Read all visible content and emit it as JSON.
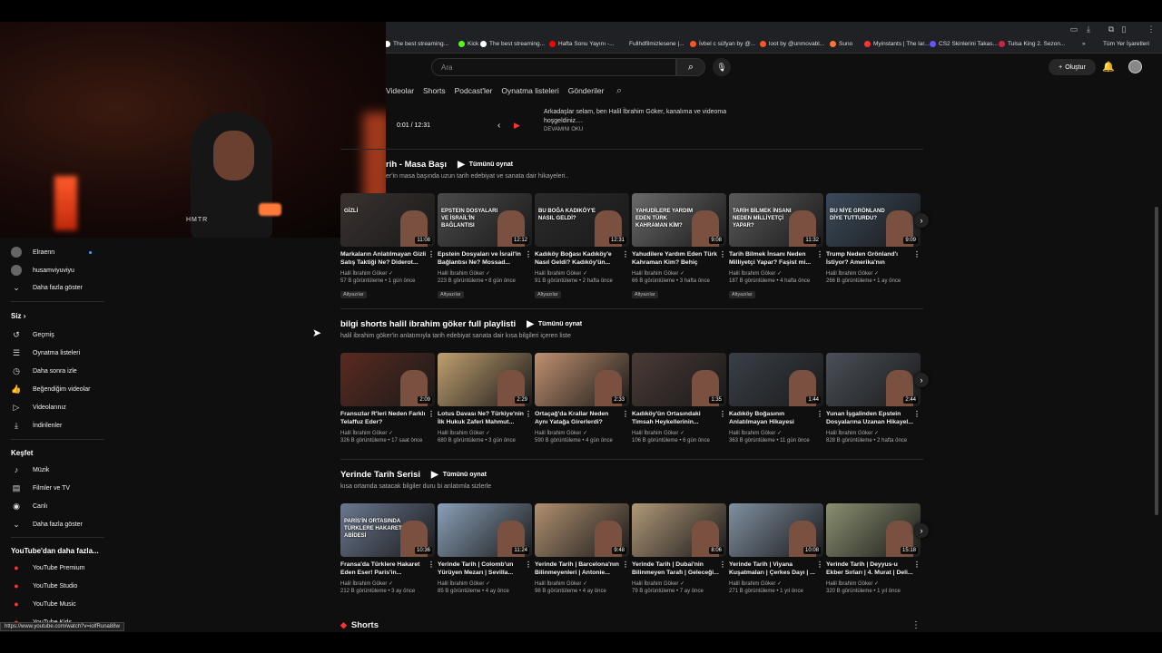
{
  "bookmarks": [
    {
      "label": "The best streaming...",
      "color": "#ffffff"
    },
    {
      "label": "Kick",
      "color": "#53fc18"
    },
    {
      "label": "The best streaming...",
      "color": "#ffffff"
    },
    {
      "label": "Hafta Sonu Yayını -...",
      "color": "#ff0000"
    },
    {
      "label": "Fullhdfilmizlesene |...",
      "color": "#222222"
    },
    {
      "label": "İvbel c süfyan by @...",
      "color": "#ff5522"
    },
    {
      "label": "loot by @unmovabl...",
      "color": "#ff5522"
    },
    {
      "label": "Suno",
      "color": "#ff7733"
    },
    {
      "label": "Myinstants | The lar...",
      "color": "#ff3333"
    },
    {
      "label": "CS2 Skinlerini Takas...",
      "color": "#6655ff"
    },
    {
      "label": "Tulsa King 2. Sezon...",
      "color": "#cc2244"
    },
    {
      "label": "»",
      "color": ""
    },
    {
      "label": "Tüm Yer İşaretleri",
      "color": ""
    }
  ],
  "search": {
    "placeholder": "Ara"
  },
  "header": {
    "create_label": "Oluştur"
  },
  "channel_tabs": [
    "Videolar",
    "Shorts",
    "Podcast'ler",
    "Oynatma listeleri",
    "Gönderiler"
  ],
  "player": {
    "time": "0:01 / 12:31",
    "description": "Arkadaşlar selam, ben Halil İbrahim Göker, kanalıma ve videoma hoşgeldiniz....",
    "more_label": "DEVAMINI OKU"
  },
  "webcam": {
    "label": "HMTR"
  },
  "shelves": [
    {
      "title": "rih - Masa Başı",
      "play_all": "Tümünü oynat",
      "subtitle": "er'in masa başında uzun tarih edebiyat ve sanata dair hikayeleri..",
      "videos": [
        {
          "title": "Markaların Anlatılmayan Gizli Satış Taktiği Ne? Diderot...",
          "channel": "Halil İbrahim Göker",
          "meta": "57 B görüntüleme • 1 gün önce",
          "duration": "11:08",
          "badge": "Altyazılar",
          "thumb_text": "GİZLİ",
          "color": "#3a3230"
        },
        {
          "title": "Epstein Dosyaları ve İsrail'in Bağlantısı Ne? Mossad...",
          "channel": "Halil İbrahim Göker",
          "meta": "223 B görüntüleme • 8 gün önce",
          "duration": "12:12",
          "badge": "Altyazılar",
          "thumb_text": "EPSTEIN DOSYALARI VE İSRAİL'İN BAĞLANTISI",
          "color": "#4a4a4a"
        },
        {
          "title": "Kadıköy Boğası Kadıköy'e Nasıl Geldi? Kadıköy'ün...",
          "channel": "Halil İbrahim Göker",
          "meta": "91 B görüntüleme • 2 hafta önce",
          "duration": "12:31",
          "badge": "Altyazılar",
          "thumb_text": "BU BOĞA KADIKÖY'E NASIL GELDİ?",
          "color": "#2a2a2a"
        },
        {
          "title": "Yahudilere Yardım Eden Türk Kahraman Kim? Behiç Erkin...",
          "channel": "Halil İbrahim Göker",
          "meta": "66 B görüntüleme • 3 hafta önce",
          "duration": "9:08",
          "badge": "Altyazılar",
          "thumb_text": "YAHUDİLERE YARDIM EDEN TÜRK KAHRAMAN KİM?",
          "color": "#6a6a6a"
        },
        {
          "title": "Tarih Bilmek İnsanı Neden Milliyetçi Yapar? Faşist mi...",
          "channel": "Halil İbrahim Göker",
          "meta": "187 B görüntüleme • 4 hafta önce",
          "duration": "11:32",
          "badge": "Altyazılar",
          "thumb_text": "TARİH BİLMEK İNSANI NEDEN MİLLİYETÇİ YAPAR?",
          "color": "#5a5a5a"
        },
        {
          "title": "Trump Neden Grönland'ı İstiyor? Amerika'nın Monroe...",
          "channel": "Halil İbrahim Göker",
          "meta": "266 B görüntüleme • 1 ay önce",
          "duration": "9:09",
          "badge": "",
          "thumb_text": "BU NİYE GRÖNLAND DİYE TUTTURDU?",
          "color": "#3a4a5a"
        }
      ]
    },
    {
      "title": "bilgi shorts halil ibrahim göker full playlisti",
      "play_all": "Tümünü oynat",
      "subtitle": "halil ibrahim göker'in anlatımıyla tarih edebiyat sanata dair kısa bilgileri içeren liste",
      "videos": [
        {
          "title": "Fransızlar R'leri Neden Farklı Telaffuz Eder?",
          "channel": "Halil İbrahim Göker",
          "meta": "326 B görüntüleme • 17 saat önce",
          "duration": "2:09",
          "badge": "",
          "thumb_text": "",
          "color": "#5a2a20"
        },
        {
          "title": "Lotus Davası Ne? Türkiye'nin İlk Hukuk Zaferi Mahmut...",
          "channel": "Halil İbrahim Göker",
          "meta": "680 B görüntüleme • 3 gün önce",
          "duration": "2:29",
          "badge": "",
          "thumb_text": "",
          "color": "#c0a070"
        },
        {
          "title": "Ortaçağ'da Krallar Neden Aynı Yatağa Girerlerdi? Giso...",
          "channel": "Halil İbrahim Göker",
          "meta": "590 B görüntüleme • 4 gün önce",
          "duration": "2:33",
          "badge": "",
          "thumb_text": "",
          "color": "#c09070"
        },
        {
          "title": "Kadıköy'ün Ortasındaki Timsah Heykellerinin...",
          "channel": "Halil İbrahim Göker",
          "meta": "106 B görüntüleme • 6 gün önce",
          "duration": "1:35",
          "badge": "",
          "thumb_text": "",
          "color": "#4a3a36"
        },
        {
          "title": "Kadıköy Boğasının Anlatılmayan Hikayesi",
          "channel": "Halil İbrahim Göker",
          "meta": "363 B görüntüleme • 11 gün önce",
          "duration": "1:44",
          "badge": "",
          "thumb_text": "",
          "color": "#3a4048"
        },
        {
          "title": "Yunan İşgalinden Epstein Dosyalarına Uzanan Hikayel...",
          "channel": "Halil İbrahim Göker",
          "meta": "828 B görüntüleme • 2 hafta önce",
          "duration": "2:44",
          "badge": "",
          "thumb_text": "",
          "color": "#4a5058"
        }
      ]
    },
    {
      "title": "Yerinde Tarih Serisi",
      "play_all": "Tümünü oynat",
      "subtitle": "kısa ortamda satacak bilgiler duru bi anlatımla sizlerle",
      "videos": [
        {
          "title": "Fransa'da Türklere Hakaret Eden Eser! Paris'in...",
          "channel": "Halil İbrahim Göker",
          "meta": "212 B görüntüleme • 3 ay önce",
          "duration": "10:36",
          "badge": "",
          "thumb_text": "PARİS'İN ORTASINDA TÜRKLERE HAKARET ABİDESİ",
          "color": "#6a7890"
        },
        {
          "title": "Yerinde Tarih | Colomb'un Yürüyen Mezarı | Sevilla...",
          "channel": "Halil İbrahim Göker",
          "meta": "85 B görüntüleme • 4 ay önce",
          "duration": "11:24",
          "badge": "",
          "thumb_text": "",
          "color": "#8aa0b8"
        },
        {
          "title": "Yerinde Tarih | Barcelona'nın Bilinmeyenleri | Antonie...",
          "channel": "Halil İbrahim Göker",
          "meta": "98 B görüntüleme • 4 ay önce",
          "duration": "9:48",
          "badge": "",
          "thumb_text": "",
          "color": "#b09070"
        },
        {
          "title": "Yerinde Tarih | Dubai'nin Bilinmeyen Tarafı | Geleceği...",
          "channel": "Halil İbrahim Göker",
          "meta": "79 B görüntüleme • 7 ay önce",
          "duration": "8:06",
          "badge": "",
          "thumb_text": "",
          "color": "#b09878"
        },
        {
          "title": "Yerinde Tarih | Viyana Kuşatmaları | Çerkes Dayı | ...",
          "channel": "Halil İbrahim Göker",
          "meta": "271 B görüntüleme • 1 yıl önce",
          "duration": "10:08",
          "badge": "",
          "thumb_text": "",
          "color": "#8090a0"
        },
        {
          "title": "Yerinde Tarih | Deyyus-u Ekber Sırları | 4. Murat | Deli...",
          "channel": "Halil İbrahim Göker",
          "meta": "320 B görüntüleme • 1 yıl önce",
          "duration": "15:18",
          "badge": "",
          "thumb_text": "",
          "color": "#8a9070"
        }
      ]
    }
  ],
  "sidebar": {
    "subs": [
      {
        "label": "Elraenn"
      },
      {
        "label": "husamviyuviyu"
      }
    ],
    "show_more_1": "Daha fazla göster",
    "you_head": "Siz",
    "you_items": [
      {
        "label": "Geçmiş",
        "icon": "history-icon",
        "glyph": "↺"
      },
      {
        "label": "Oynatma listeleri",
        "icon": "playlist-icon",
        "glyph": "☰"
      },
      {
        "label": "Daha sonra izle",
        "icon": "clock-icon",
        "glyph": "◷"
      },
      {
        "label": "Beğendiğim videolar",
        "icon": "thumbs-up-icon",
        "glyph": "👍"
      },
      {
        "label": "Videolarınız",
        "icon": "video-icon",
        "glyph": "▷"
      },
      {
        "label": "İndirilenler",
        "icon": "download-icon",
        "glyph": "⤓"
      }
    ],
    "explore_head": "Keşfet",
    "explore_items": [
      {
        "label": "Müzik",
        "icon": "music-icon",
        "glyph": "♪"
      },
      {
        "label": "Filmler ve TV",
        "icon": "film-icon",
        "glyph": "▤"
      },
      {
        "label": "Canlı",
        "icon": "live-icon",
        "glyph": "◉"
      },
      {
        "label": "Daha fazla göster",
        "icon": "chevron-down-icon",
        "glyph": "⌄"
      }
    ],
    "more_head": "YouTube'dan daha fazla...",
    "more_items": [
      {
        "label": "YouTube Premium"
      },
      {
        "label": "YouTube Studio"
      },
      {
        "label": "YouTube Music"
      },
      {
        "label": "YouTube Kids"
      }
    ]
  },
  "status_url": "https://www.youtube.com/watch?v=iolfRuna88w",
  "shorts_title": "Shorts"
}
